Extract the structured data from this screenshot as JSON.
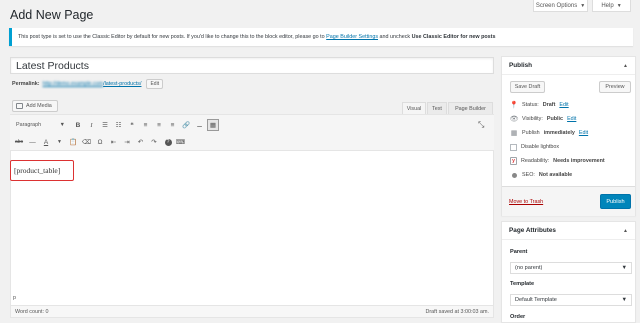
{
  "header": {
    "title": "Add New Page",
    "screen_options": "Screen Options",
    "help": "Help"
  },
  "notice": {
    "text_before": "This post type is set to use the Classic Editor by default for new posts. If you'd like to change this to the block editor, please go to",
    "link": "Page Builder Settings",
    "text_middle": "and uncheck",
    "bold": "Use Classic Editor for new posts"
  },
  "title_input": {
    "value": "Latest Products"
  },
  "permalink": {
    "label": "Permalink:",
    "host": "http://demo.example.com",
    "slug": "/latest-products/",
    "edit_label": "Edit"
  },
  "editor": {
    "add_media": "Add Media",
    "tabs": {
      "visual": "Visual",
      "text": "Text",
      "builder": "Page Builder"
    },
    "format": "Paragraph",
    "content": "[product_table]",
    "path": "p",
    "word_count": "Word count: 0",
    "draft_saved": "Draft saved at 3:00:03 am."
  },
  "toolbar_icons": {
    "bold": "B",
    "italic": "I",
    "bullets": "☰",
    "numbers": "☷",
    "quote": "❝",
    "align_left": "≡",
    "align_center": "≡",
    "align_right": "≡",
    "link": "🔗",
    "more": "⚊",
    "toggle": "▦",
    "strike": "abc",
    "hr": "—",
    "color": "A",
    "paste": "📋",
    "clear": "⌫",
    "omega": "Ω",
    "outdent": "⇤",
    "indent": "⇥",
    "undo": "↶",
    "redo": "↷",
    "help": "?",
    "keyboard": "⌨",
    "fullscreen": "⤡"
  },
  "publish": {
    "title": "Publish",
    "save_draft": "Save Draft",
    "preview": "Preview",
    "status_label": "Status:",
    "status_value": "Draft",
    "visibility_label": "Visibility:",
    "visibility_value": "Public",
    "publish_label": "Publish",
    "publish_value": "immediately",
    "edit": "Edit",
    "disable_lightbox": "Disable lightbox",
    "readability_label": "Readability:",
    "readability_value": "Needs improvement",
    "seo_label": "SEO:",
    "seo_value": "Not available",
    "move_trash": "Move to Trash",
    "publish_button": "Publish"
  },
  "page_attributes": {
    "title": "Page Attributes",
    "parent_label": "Parent",
    "parent_value": "(no parent)",
    "template_label": "Template",
    "template_value": "Default Template",
    "order_label": "Order"
  },
  "colors": {
    "accent": "#0073aa",
    "publish_button": "#0085ba",
    "notice_border": "#00a0d2",
    "trash": "#a00000",
    "shortcode_border": "#dc3232"
  }
}
